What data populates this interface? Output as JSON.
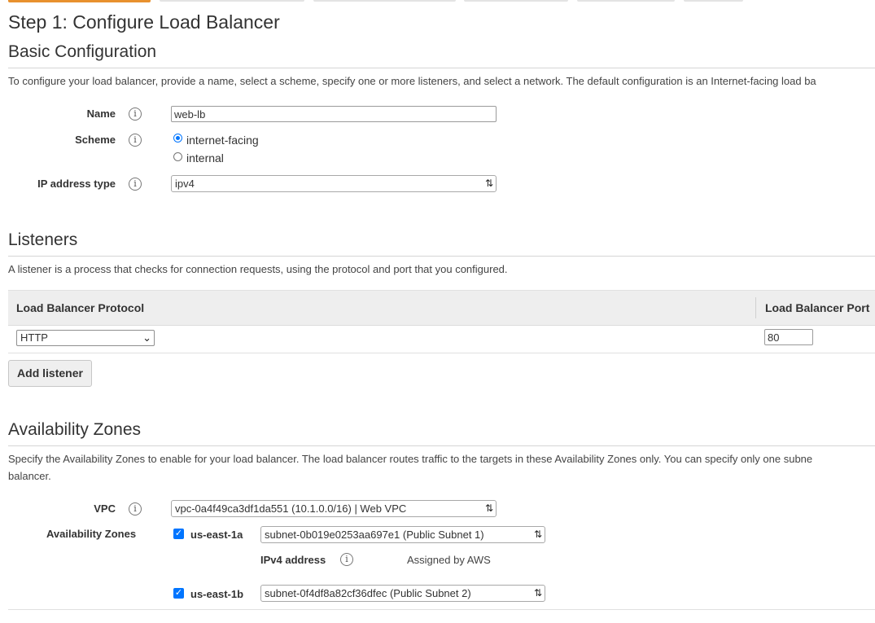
{
  "wizard_tabs": [
    {
      "active": true
    },
    {
      "active": false
    },
    {
      "active": false
    },
    {
      "active": false
    },
    {
      "active": false
    },
    {
      "active": false
    }
  ],
  "page_title": "Step 1: Configure Load Balancer",
  "basic": {
    "heading": "Basic Configuration",
    "description": "To configure your load balancer, provide a name, select a scheme, specify one or more listeners, and select a network. The default configuration is an Internet-facing load ba",
    "name_label": "Name",
    "name_value": "web-lb",
    "scheme_label": "Scheme",
    "scheme_options": {
      "internet_facing": "internet-facing",
      "internal": "internal"
    },
    "scheme_selected": "internet-facing",
    "ip_type_label": "IP address type",
    "ip_type_value": "ipv4"
  },
  "listeners": {
    "heading": "Listeners",
    "description": "A listener is a process that checks for connection requests, using the protocol and port that you configured.",
    "columns": {
      "protocol": "Load Balancer Protocol",
      "port": "Load Balancer Port"
    },
    "rows": [
      {
        "protocol": "HTTP",
        "port": "80"
      }
    ],
    "add_button": "Add listener"
  },
  "availability": {
    "heading": "Availability Zones",
    "description_line1": "Specify the Availability Zones to enable for your load balancer. The load balancer routes traffic to the targets in these Availability Zones only. You can specify only one subne",
    "description_line2": "balancer.",
    "vpc_label": "VPC",
    "vpc_value": "vpc-0a4f49ca3df1da551 (10.1.0.0/16) | Web VPC",
    "zones_label": "Availability Zones",
    "zones": [
      {
        "name": "us-east-1a",
        "checked": true,
        "subnet": "subnet-0b019e0253aa697e1 (Public Subnet 1)"
      },
      {
        "name": "us-east-1b",
        "checked": true,
        "subnet": "subnet-0f4df8a82cf36dfec (Public Subnet 2)"
      }
    ],
    "ipv4_label": "IPv4 address",
    "ipv4_value": "Assigned by AWS"
  },
  "icons": {
    "info": "info-icon",
    "select_arrows": "chevron-up-down-icon",
    "dropdown": "chevron-down-icon",
    "checkbox": "check-icon"
  },
  "colors": {
    "active_tab": "#e8912e",
    "radio_checkbox": "#0075ff",
    "table_header": "#eeeeee"
  }
}
